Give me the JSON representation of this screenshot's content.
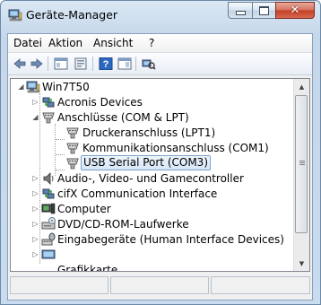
{
  "window": {
    "title": "Geräte-Manager"
  },
  "menubar": {
    "items": [
      "Datei",
      "Aktion",
      "Ansicht",
      "?"
    ]
  },
  "toolbar": {
    "buttons": [
      "back-icon",
      "forward-icon",
      "show-hide-console-tree-icon",
      "properties-icon",
      "help-icon",
      "show-action-pane-icon",
      "scan-hardware-icon"
    ]
  },
  "tree": {
    "root": "Win7T50",
    "items": [
      {
        "label": "Acronis Devices",
        "icon": "network-adapter-icon"
      },
      {
        "label": "Anschlüsse (COM & LPT)",
        "icon": "port-icon"
      },
      {
        "label": "Druckeranschluss (LPT1)",
        "icon": "port-icon"
      },
      {
        "label": "Kommunikationsanschluss (COM1)",
        "icon": "port-icon"
      },
      {
        "label": "USB Serial Port (COM3)",
        "icon": "port-icon",
        "selected": true
      },
      {
        "label": "Audio-, Video- und Gamecontroller",
        "icon": "speaker-icon"
      },
      {
        "label": "cifX Communication Interface",
        "icon": "network-adapter-icon"
      },
      {
        "label": "Computer",
        "icon": "computer-icon"
      },
      {
        "label": "DVD/CD-ROM-Laufwerke",
        "icon": "dvd-drive-icon"
      },
      {
        "label": "Eingabegeräte (Human Interface Devices)",
        "icon": "hid-icon"
      },
      {
        "label": "Grafikkarte",
        "icon": "display-adapter-icon"
      }
    ]
  },
  "colors": {
    "selection": "#d6e6f8",
    "titlebar": "#c5d7ea",
    "close": "#c43c25"
  }
}
